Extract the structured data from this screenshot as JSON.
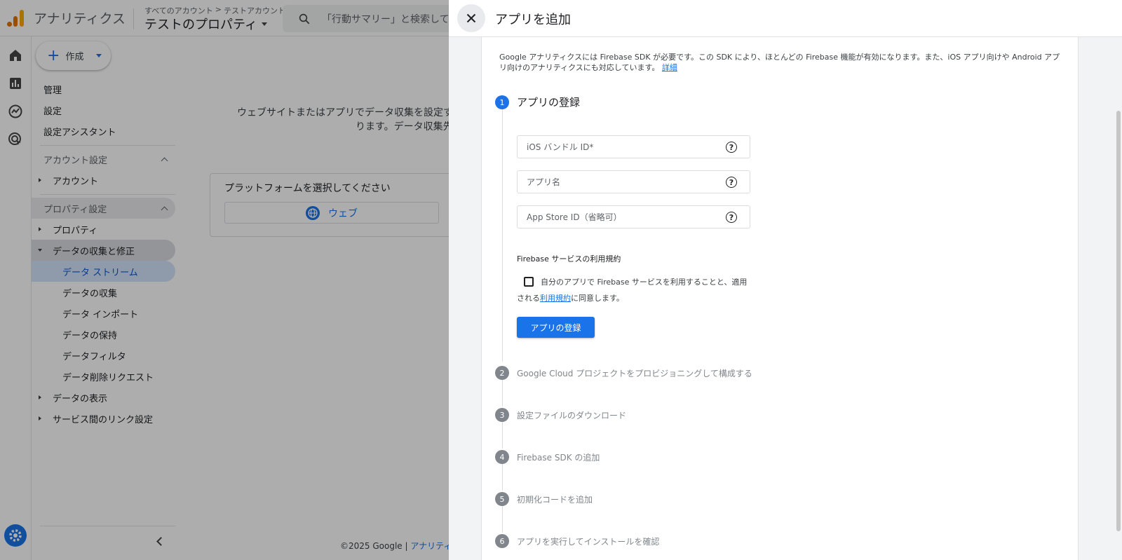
{
  "app": {
    "title": "アナリティクス",
    "breadcrumb": [
      "すべてのアカウント",
      ">",
      "テストアカウント"
    ],
    "property_name": "テストのプロパティ",
    "search_placeholder": "「行動サマリー」と検索してみ"
  },
  "create_button": {
    "label": "作成"
  },
  "nav": {
    "top_items": [
      "管理",
      "設定",
      "設定アシスタント"
    ],
    "account_section": "アカウント設定",
    "account_item": "アカウント",
    "property_section": "プロパティ設定",
    "property_item": "プロパティ",
    "data_collection": "データの収集と修正",
    "sub_items": [
      "データ ストリーム",
      "データの収集",
      "データ インポート",
      "データの保持",
      "データフィルタ",
      "データ削除リクエスト"
    ],
    "data_display": "データの表示",
    "service_links": "サービス間のリンク設定"
  },
  "main": {
    "message_line1": "ウェブサイトまたはアプリでデータ収集を設定する",
    "message_line2": "ります。データ収集先",
    "platform_heading": "プラットフォームを選択してください",
    "web_label": "ウェブ",
    "footer_copyright": "©2025 Google | ",
    "footer_link": "アナリティク"
  },
  "drawer": {
    "title": "アプリを追加",
    "intro": "Google アナリティクスには Firebase SDK が必要です。この SDK により、ほとんどの Firebase 機能が有効になります。また、iOS アプリ向けや Android アプリ向けのアナリティクスにも対応しています。",
    "intro_link": "詳細",
    "steps": [
      {
        "num": "1",
        "label": "アプリの登録"
      },
      {
        "num": "2",
        "label": "Google Cloud プロジェクトをプロビジョニングして構成する"
      },
      {
        "num": "3",
        "label": "設定ファイルのダウンロード"
      },
      {
        "num": "4",
        "label": "Firebase SDK の追加"
      },
      {
        "num": "5",
        "label": "初期化コードを追加"
      },
      {
        "num": "6",
        "label": "アプリを実行してインストールを確認"
      }
    ],
    "fields": {
      "bundle_id": "iOS バンドル ID*",
      "app_name": "アプリ名",
      "app_store_id": "App Store ID（省略可）"
    },
    "help_glyph": "?",
    "terms_title": "Firebase サービスの利用規約",
    "terms_text_before": "自分のアプリで Firebase サービスを利用することと、適用される",
    "terms_link": "利用規約",
    "terms_text_after": "に同意します。",
    "register_button": "アプリの登録"
  }
}
